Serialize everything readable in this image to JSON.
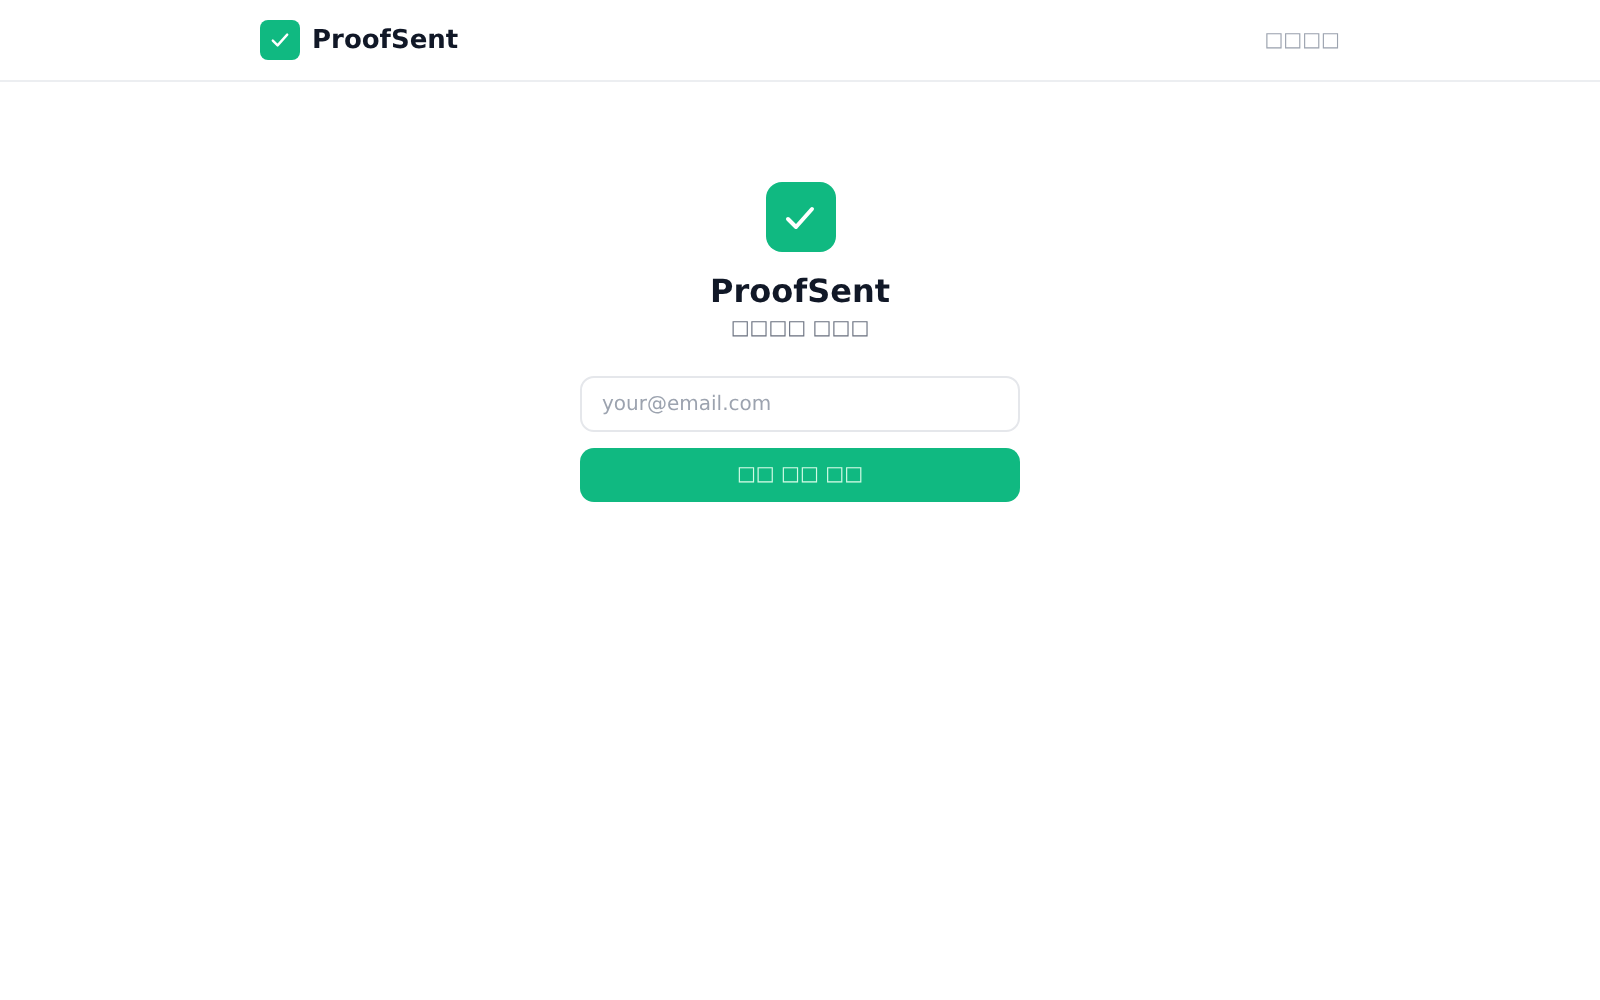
{
  "header": {
    "brand": "ProofSent",
    "nav_link": "□□□□"
  },
  "login": {
    "title": "ProofSent",
    "subtitle": "□□□□ □□□",
    "email": {
      "placeholder": "your@email.com"
    },
    "submit": "□□ □□ □□"
  }
}
